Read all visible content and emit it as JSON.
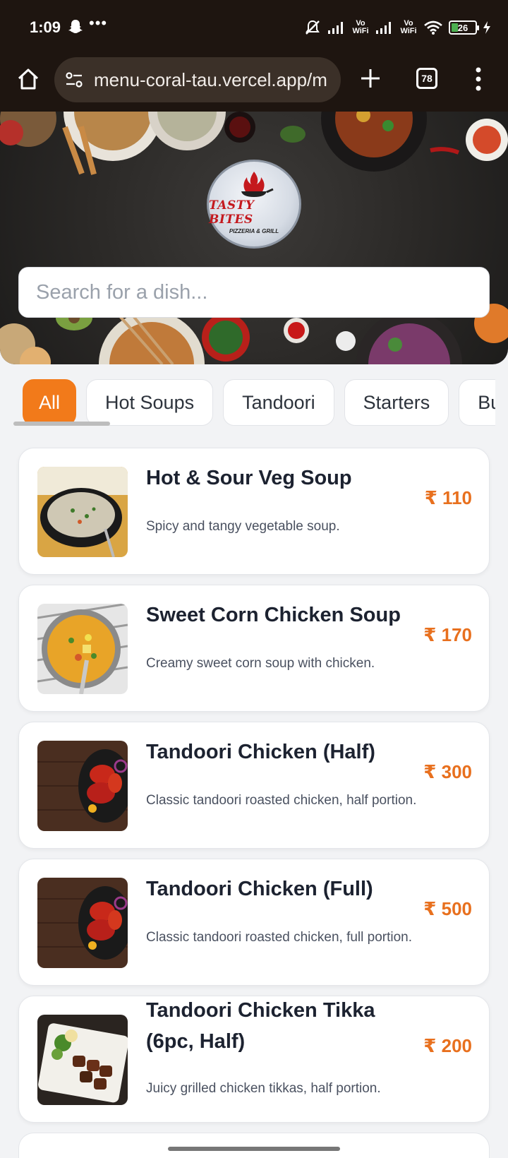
{
  "status_bar": {
    "time": "1:09",
    "dots": "•••",
    "vowifi_1": "Vo WiFi",
    "vowifi_2": "Vo WiFi",
    "battery": "26"
  },
  "browser": {
    "url": "menu-coral-tau.vercel.app/m",
    "tab_count": "78"
  },
  "hero": {
    "logo_title": "TASTY BITES",
    "logo_subtitle": "PIZZERIA & GRILL",
    "search_placeholder": "Search for a dish..."
  },
  "categories": [
    {
      "label": "All",
      "active": true
    },
    {
      "label": "Hot Soups",
      "active": false
    },
    {
      "label": "Tandoori",
      "active": false
    },
    {
      "label": "Starters",
      "active": false
    },
    {
      "label": "Burgers",
      "active": false
    }
  ],
  "dishes": [
    {
      "name": "Hot & Sour Veg Soup",
      "description": "Spicy and tangy vegetable soup.",
      "price": "₹ 110",
      "image": "soup-bowl-image"
    },
    {
      "name": "Sweet Corn Chicken Soup",
      "description": "Creamy sweet corn soup with chicken.",
      "price": "₹ 170",
      "image": "corn-soup-image"
    },
    {
      "name": "Tandoori Chicken (Half)",
      "description": "Classic tandoori roasted chicken, half portion.",
      "price": "₹ 300",
      "image": "tandoori-chicken-image"
    },
    {
      "name": "Tandoori Chicken (Full)",
      "description": "Classic tandoori roasted chicken, full portion.",
      "price": "₹ 500",
      "image": "tandoori-chicken-image"
    },
    {
      "name": "Tandoori Chicken Tikka (6pc, Half)",
      "description": "Juicy grilled chicken tikkas, half portion.",
      "price": "₹ 200",
      "image": "chicken-tikka-image"
    }
  ],
  "colors": {
    "accent": "#f27a1a",
    "price": "#e8701e",
    "chrome": "#1e1510"
  }
}
